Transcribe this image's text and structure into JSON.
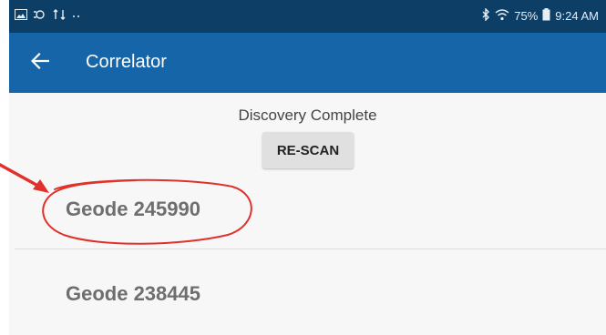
{
  "status_bar": {
    "battery": "75%",
    "time": "9:24 AM",
    "left_icons": [
      "image-notification-icon",
      "sync-icon",
      "transfer-icon",
      "more-dots-icon"
    ],
    "right_icons": [
      "bluetooth-icon",
      "wifi-icon",
      "battery-icon"
    ]
  },
  "app_bar": {
    "title": "Correlator",
    "back_icon": "arrow-left-icon",
    "background": "#1565a8"
  },
  "discovery": {
    "status": "Discovery Complete",
    "rescan_label": "RE-SCAN"
  },
  "devices": [
    {
      "label": "Geode 245990"
    },
    {
      "label": "Geode 238445"
    }
  ],
  "annotation": {
    "color": "#e0312b",
    "shapes": [
      "arrow",
      "ellipse"
    ]
  }
}
